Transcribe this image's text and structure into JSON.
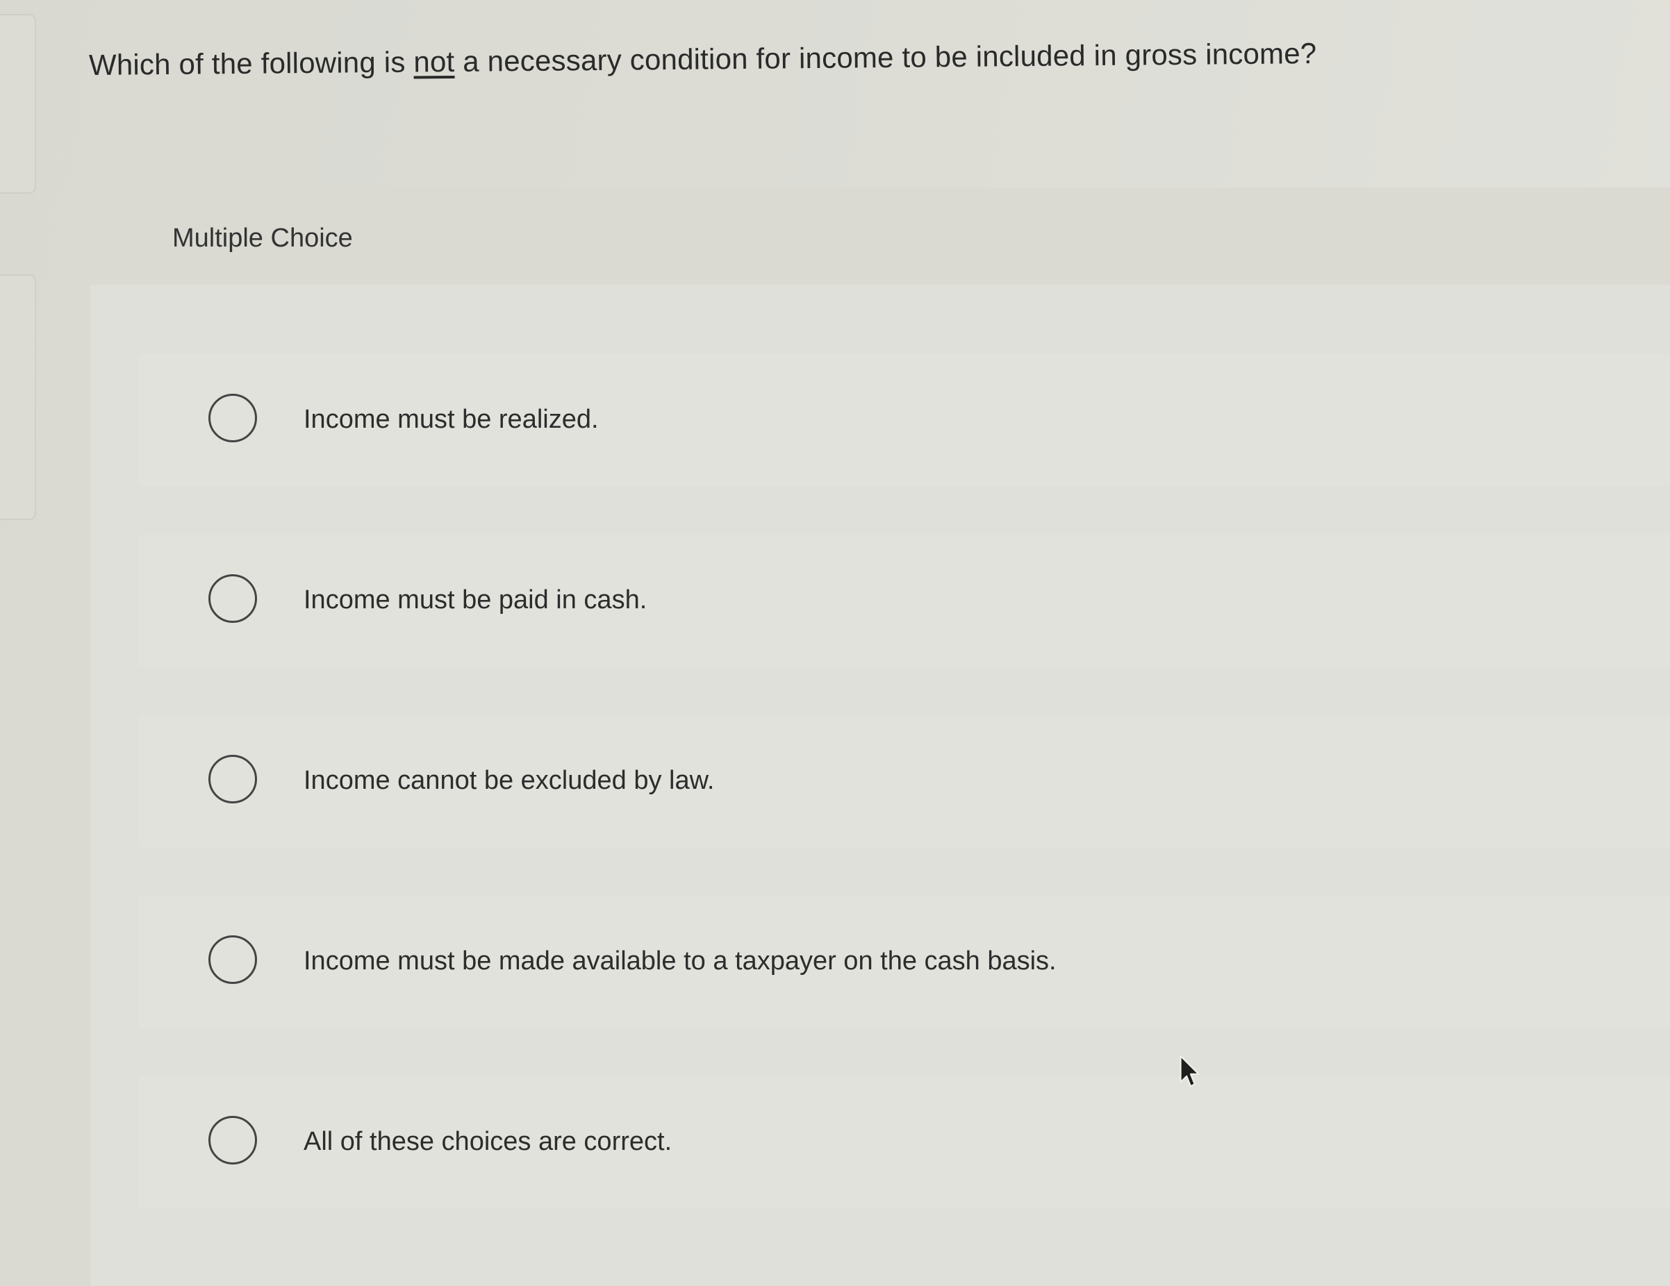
{
  "question": {
    "prefix": "Which of the following is ",
    "emphasis": "not",
    "suffix": " a necessary condition for income to be included in gross income?"
  },
  "mc": {
    "label": "Multiple Choice"
  },
  "choices": [
    {
      "label": "Income must be realized.",
      "selected": false
    },
    {
      "label": "Income must be paid in cash.",
      "selected": false
    },
    {
      "label": "Income cannot be excluded by law.",
      "selected": false
    },
    {
      "label": "Income must be made available to a taxpayer on the cash basis.",
      "selected": false
    },
    {
      "label": "All of these choices are correct.",
      "selected": false
    }
  ],
  "cursor": {
    "icon": "mouse-pointer-icon"
  }
}
